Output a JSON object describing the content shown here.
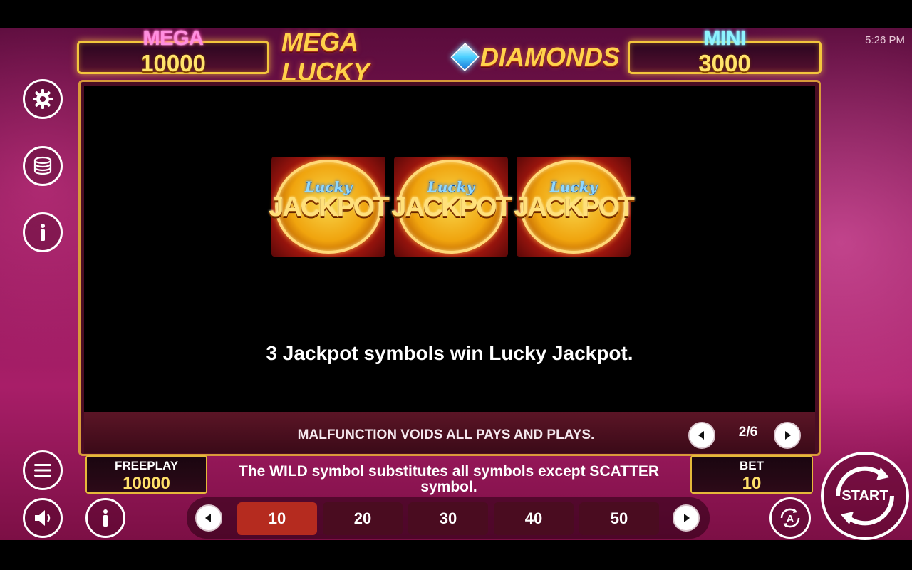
{
  "status_bar": {
    "time": "5:26 PM"
  },
  "jackpots": {
    "mega": {
      "label": "MEGA",
      "value": "10000"
    },
    "mini": {
      "label": "MINI",
      "value": "3000"
    }
  },
  "logo": {
    "part1": "MEGA LUCKY",
    "part2": "DIAMONDS"
  },
  "paytable": {
    "symbol": {
      "top": "Lucky",
      "main": "JACKPOT",
      "count": 3
    },
    "description": "3 Jackpot symbols win Lucky Jackpot.",
    "footer_notice": "MALFUNCTION VOIDS ALL PAYS AND PLAYS.",
    "page_indicator": "2/6"
  },
  "bottom": {
    "freeplay": {
      "label": "FREEPLAY",
      "value": "10000"
    },
    "message": "The WILD symbol substitutes all symbols except SCATTER symbol.",
    "bet": {
      "label": "BET",
      "value": "10"
    },
    "bet_options": [
      "10",
      "20",
      "30",
      "40",
      "50"
    ],
    "selected_bet": "10",
    "start_label": "START"
  },
  "icons": {
    "settings": "gear-icon",
    "coins": "coin-stack-icon",
    "info": "info-icon",
    "menu": "menu-icon",
    "sound": "speaker-icon",
    "prev": "arrow-left-icon",
    "next": "arrow-right-icon",
    "autoplay": "autoplay-icon",
    "start": "spin-arrows-icon"
  },
  "colors": {
    "gold_border": "#f3c63d",
    "jackpot_value": "#ffe36b",
    "mega_pink": "#ff8ee0",
    "mini_cyan": "#8ff4ff",
    "active_bet": "#b52b1f",
    "background": "#a81e68"
  }
}
